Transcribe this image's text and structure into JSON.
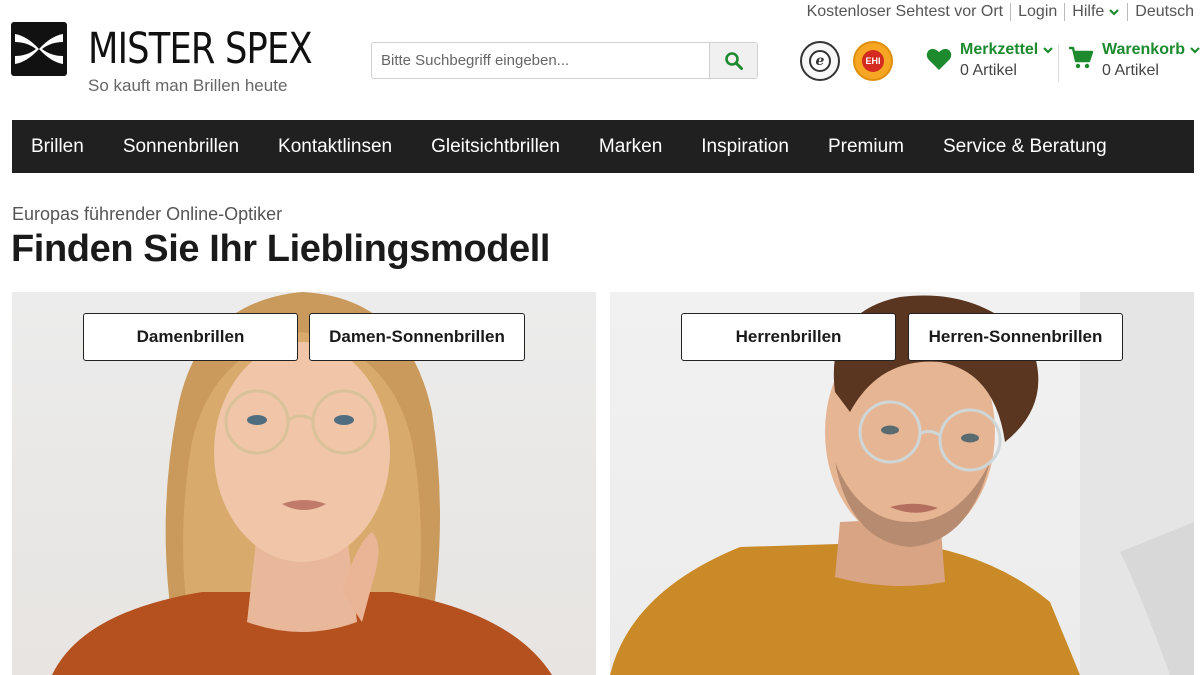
{
  "utility": {
    "sehtest": "Kostenloser Sehtest vor Ort",
    "login": "Login",
    "hilfe": "Hilfe",
    "language": "Deutsch"
  },
  "logo": {
    "name": "MISTER SPEX",
    "tagline": "So kauft man Brillen heute"
  },
  "search": {
    "placeholder": "Bitte Suchbegriff eingeben..."
  },
  "wishlist": {
    "label": "Merkzettel",
    "count": "0 Artikel"
  },
  "cart": {
    "label": "Warenkorb",
    "count": "0 Artikel"
  },
  "nav": [
    "Brillen",
    "Sonnenbrillen",
    "Kontaktlinsen",
    "Gleitsichtbrillen",
    "Marken",
    "Inspiration",
    "Premium",
    "Service & Beratung"
  ],
  "hero": {
    "subtitle": "Europas führender Online-Optiker",
    "title": "Finden Sie Ihr Lieblingsmodell"
  },
  "tiles": {
    "women": {
      "primary": "Damenbrillen",
      "secondary": "Damen-Sonnenbrillen"
    },
    "men": {
      "primary": "Herrenbrillen",
      "secondary": "Herren-Sonnenbrillen"
    }
  },
  "colors": {
    "accent": "#1d8a2e",
    "nav_bg": "#202020"
  }
}
